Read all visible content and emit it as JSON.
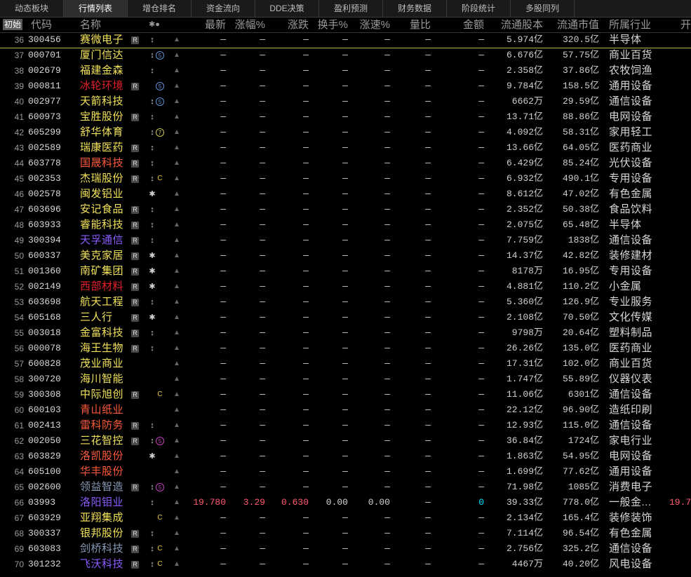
{
  "tabs": [
    "动态板块",
    "行情列表",
    "增仓排名",
    "资金流向",
    "DDE决策",
    "盈利预测",
    "财务数据",
    "阶段统计",
    "多股同列"
  ],
  "active_tab": 1,
  "header": {
    "init": "初始",
    "code": "代码",
    "name": "名称",
    "icons": "✱●",
    "latest": "最新",
    "pct": "涨幅%",
    "change": "涨跌",
    "turnover": "换手%",
    "speed": "涨速%",
    "vol_ratio": "量比",
    "amount": "金额",
    "float_shares": "流通股本",
    "float_value": "流通市值",
    "industry": "所属行业",
    "open": "开"
  },
  "colors": {
    "yellow": "#f2e25a",
    "red": "#e3202a",
    "orange_red": "#ff5a3a",
    "purple": "#8a5cff",
    "blue": "#5f8fd8",
    "cyan": "#00e0ff",
    "pink": "#ff5a6e",
    "bluegray": "#8a9ab8"
  },
  "rows": [
    {
      "idx": "36",
      "code": "300456",
      "name": "赛微电子",
      "nc": "#f2e25a",
      "r": "R",
      "i1": "↕",
      "i2": "",
      "i2c": "",
      "i2t": "",
      "latest": "—",
      "pct": "—",
      "chg": "—",
      "turn": "—",
      "speed": "—",
      "vr": "—",
      "amt": "—",
      "fs": "5.974亿",
      "fv": "320.5亿",
      "ind": "半导体",
      "open": ""
    },
    {
      "idx": "37",
      "code": "000701",
      "name": "厦门信达",
      "nc": "#f2e25a",
      "r": "",
      "i1": "↕",
      "i2": "5",
      "i2c": "#5f8fd8",
      "i2t": "circle",
      "latest": "—",
      "pct": "—",
      "chg": "—",
      "turn": "—",
      "speed": "—",
      "vr": "—",
      "amt": "—",
      "fs": "6.676亿",
      "fv": "57.75亿",
      "ind": "商业百货",
      "open": ""
    },
    {
      "idx": "38",
      "code": "002679",
      "name": "福建金森",
      "nc": "#f2e25a",
      "r": "",
      "i1": "↕",
      "i2": "",
      "i2c": "",
      "i2t": "",
      "latest": "—",
      "pct": "—",
      "chg": "—",
      "turn": "—",
      "speed": "—",
      "vr": "—",
      "amt": "—",
      "fs": "2.358亿",
      "fv": "37.86亿",
      "ind": "农牧饲渔",
      "open": ""
    },
    {
      "idx": "39",
      "code": "000811",
      "name": "冰轮环境",
      "nc": "#e3202a",
      "r": "R",
      "i1": "",
      "i2": "5",
      "i2c": "#5f8fd8",
      "i2t": "circle",
      "latest": "—",
      "pct": "—",
      "chg": "—",
      "turn": "—",
      "speed": "—",
      "vr": "—",
      "amt": "—",
      "fs": "9.784亿",
      "fv": "158.5亿",
      "ind": "通用设备",
      "open": ""
    },
    {
      "idx": "40",
      "code": "002977",
      "name": "天箭科技",
      "nc": "#f2e25a",
      "r": "",
      "i1": "↕",
      "i2": "5",
      "i2c": "#5f8fd8",
      "i2t": "circle",
      "latest": "—",
      "pct": "—",
      "chg": "—",
      "turn": "—",
      "speed": "—",
      "vr": "—",
      "amt": "—",
      "fs": "6662万",
      "fv": "29.59亿",
      "ind": "通信设备",
      "open": ""
    },
    {
      "idx": "41",
      "code": "600973",
      "name": "宝胜股份",
      "nc": "#f2e25a",
      "r": "R",
      "i1": "↕",
      "i2": "",
      "i2c": "",
      "i2t": "",
      "latest": "—",
      "pct": "—",
      "chg": "—",
      "turn": "—",
      "speed": "—",
      "vr": "—",
      "amt": "—",
      "fs": "13.71亿",
      "fv": "88.86亿",
      "ind": "电网设备",
      "open": ""
    },
    {
      "idx": "42",
      "code": "605299",
      "name": "舒华体育",
      "nc": "#f2e25a",
      "r": "",
      "i1": "↕",
      "i2": "7",
      "i2c": "#c8c85a",
      "i2t": "circle",
      "latest": "—",
      "pct": "—",
      "chg": "—",
      "turn": "—",
      "speed": "—",
      "vr": "—",
      "amt": "—",
      "fs": "4.092亿",
      "fv": "58.31亿",
      "ind": "家用轻工",
      "open": ""
    },
    {
      "idx": "43",
      "code": "002589",
      "name": "瑞康医药",
      "nc": "#f2e25a",
      "r": "R",
      "i1": "↕",
      "i2": "",
      "i2c": "",
      "i2t": "",
      "latest": "—",
      "pct": "—",
      "chg": "—",
      "turn": "—",
      "speed": "—",
      "vr": "—",
      "amt": "—",
      "fs": "13.66亿",
      "fv": "64.05亿",
      "ind": "医药商业",
      "open": ""
    },
    {
      "idx": "44",
      "code": "603778",
      "name": "国晟科技",
      "nc": "#ff5a3a",
      "r": "R",
      "i1": "↕",
      "i2": "",
      "i2c": "",
      "i2t": "",
      "latest": "—",
      "pct": "—",
      "chg": "—",
      "turn": "—",
      "speed": "—",
      "vr": "—",
      "amt": "—",
      "fs": "6.429亿",
      "fv": "85.24亿",
      "ind": "光伏设备",
      "open": ""
    },
    {
      "idx": "45",
      "code": "002353",
      "name": "杰瑞股份",
      "nc": "#f2e25a",
      "r": "R",
      "i1": "↕",
      "i2": "C",
      "i2c": "#e8c830",
      "i2t": "letter",
      "latest": "—",
      "pct": "—",
      "chg": "—",
      "turn": "—",
      "speed": "—",
      "vr": "—",
      "amt": "—",
      "fs": "6.932亿",
      "fv": "490.1亿",
      "ind": "专用设备",
      "open": ""
    },
    {
      "idx": "46",
      "code": "002578",
      "name": "闽发铝业",
      "nc": "#f2e25a",
      "r": "",
      "i1": "✱",
      "i2": "",
      "i2c": "",
      "i2t": "",
      "latest": "—",
      "pct": "—",
      "chg": "—",
      "turn": "—",
      "speed": "—",
      "vr": "—",
      "amt": "—",
      "fs": "8.612亿",
      "fv": "47.02亿",
      "ind": "有色金属",
      "open": ""
    },
    {
      "idx": "47",
      "code": "603696",
      "name": "安记食品",
      "nc": "#f2e25a",
      "r": "R",
      "i1": "↕",
      "i2": "",
      "i2c": "",
      "i2t": "",
      "latest": "—",
      "pct": "—",
      "chg": "—",
      "turn": "—",
      "speed": "—",
      "vr": "—",
      "amt": "—",
      "fs": "2.352亿",
      "fv": "50.38亿",
      "ind": "食品饮料",
      "open": ""
    },
    {
      "idx": "48",
      "code": "603933",
      "name": "睿能科技",
      "nc": "#f2e25a",
      "r": "R",
      "i1": "↕",
      "i2": "",
      "i2c": "",
      "i2t": "",
      "latest": "—",
      "pct": "—",
      "chg": "—",
      "turn": "—",
      "speed": "—",
      "vr": "—",
      "amt": "—",
      "fs": "2.075亿",
      "fv": "65.48亿",
      "ind": "半导体",
      "open": ""
    },
    {
      "idx": "49",
      "code": "300394",
      "name": "天孚通信",
      "nc": "#8a5cff",
      "r": "R",
      "i1": "↕",
      "i2": "",
      "i2c": "",
      "i2t": "",
      "latest": "—",
      "pct": "—",
      "chg": "—",
      "turn": "—",
      "speed": "—",
      "vr": "—",
      "amt": "—",
      "fs": "7.759亿",
      "fv": "1838亿",
      "ind": "通信设备",
      "open": ""
    },
    {
      "idx": "50",
      "code": "600337",
      "name": "美克家居",
      "nc": "#f2e25a",
      "r": "R",
      "i1": "✱",
      "i2": "",
      "i2c": "",
      "i2t": "",
      "latest": "—",
      "pct": "—",
      "chg": "—",
      "turn": "—",
      "speed": "—",
      "vr": "—",
      "amt": "—",
      "fs": "14.37亿",
      "fv": "42.82亿",
      "ind": "装修建材",
      "open": ""
    },
    {
      "idx": "51",
      "code": "001360",
      "name": "南矿集团",
      "nc": "#f2e25a",
      "r": "R",
      "i1": "✱",
      "i2": "",
      "i2c": "",
      "i2t": "",
      "latest": "—",
      "pct": "—",
      "chg": "—",
      "turn": "—",
      "speed": "—",
      "vr": "—",
      "amt": "—",
      "fs": "8178万",
      "fv": "16.95亿",
      "ind": "专用设备",
      "open": ""
    },
    {
      "idx": "52",
      "code": "002149",
      "name": "西部材料",
      "nc": "#e3202a",
      "r": "R",
      "i1": "✱",
      "i2": "",
      "i2c": "",
      "i2t": "",
      "latest": "—",
      "pct": "—",
      "chg": "—",
      "turn": "—",
      "speed": "—",
      "vr": "—",
      "amt": "—",
      "fs": "4.881亿",
      "fv": "110.2亿",
      "ind": "小金属",
      "open": ""
    },
    {
      "idx": "53",
      "code": "603698",
      "name": "航天工程",
      "nc": "#f2e25a",
      "r": "R",
      "i1": "↕",
      "i2": "",
      "i2c": "",
      "i2t": "",
      "latest": "—",
      "pct": "—",
      "chg": "—",
      "turn": "—",
      "speed": "—",
      "vr": "—",
      "amt": "—",
      "fs": "5.360亿",
      "fv": "126.9亿",
      "ind": "专业服务",
      "open": ""
    },
    {
      "idx": "54",
      "code": "605168",
      "name": "三人行",
      "nc": "#f2e25a",
      "r": "R",
      "i1": "✱",
      "i2": "",
      "i2c": "",
      "i2t": "",
      "latest": "—",
      "pct": "—",
      "chg": "—",
      "turn": "—",
      "speed": "—",
      "vr": "—",
      "amt": "—",
      "fs": "2.108亿",
      "fv": "70.50亿",
      "ind": "文化传媒",
      "open": ""
    },
    {
      "idx": "55",
      "code": "003018",
      "name": "金富科技",
      "nc": "#f2e25a",
      "r": "R",
      "i1": "↕",
      "i2": "",
      "i2c": "",
      "i2t": "",
      "latest": "—",
      "pct": "—",
      "chg": "—",
      "turn": "—",
      "speed": "—",
      "vr": "—",
      "amt": "—",
      "fs": "9798万",
      "fv": "20.64亿",
      "ind": "塑料制品",
      "open": ""
    },
    {
      "idx": "56",
      "code": "000078",
      "name": "海王生物",
      "nc": "#f2e25a",
      "r": "R",
      "i1": "↕",
      "i2": "",
      "i2c": "",
      "i2t": "",
      "latest": "—",
      "pct": "—",
      "chg": "—",
      "turn": "—",
      "speed": "—",
      "vr": "—",
      "amt": "—",
      "fs": "26.26亿",
      "fv": "135.0亿",
      "ind": "医药商业",
      "open": ""
    },
    {
      "idx": "57",
      "code": "600828",
      "name": "茂业商业",
      "nc": "#f2e25a",
      "r": "",
      "i1": "",
      "i2": "",
      "i2c": "",
      "i2t": "",
      "latest": "—",
      "pct": "—",
      "chg": "—",
      "turn": "—",
      "speed": "—",
      "vr": "—",
      "amt": "—",
      "fs": "17.31亿",
      "fv": "102.0亿",
      "ind": "商业百货",
      "open": ""
    },
    {
      "idx": "58",
      "code": "300720",
      "name": "海川智能",
      "nc": "#f2e25a",
      "r": "",
      "i1": "",
      "i2": "",
      "i2c": "",
      "i2t": "",
      "latest": "—",
      "pct": "—",
      "chg": "—",
      "turn": "—",
      "speed": "—",
      "vr": "—",
      "amt": "—",
      "fs": "1.747亿",
      "fv": "55.89亿",
      "ind": "仪器仪表",
      "open": ""
    },
    {
      "idx": "59",
      "code": "300308",
      "name": "中际旭创",
      "nc": "#f2e25a",
      "r": "R",
      "i1": "",
      "i2": "C",
      "i2c": "#e8c830",
      "i2t": "letter",
      "latest": "—",
      "pct": "—",
      "chg": "—",
      "turn": "—",
      "speed": "—",
      "vr": "—",
      "amt": "—",
      "fs": "11.06亿",
      "fv": "6301亿",
      "ind": "通信设备",
      "open": ""
    },
    {
      "idx": "60",
      "code": "600103",
      "name": "青山纸业",
      "nc": "#ff5a3a",
      "r": "",
      "i1": "",
      "i2": "",
      "i2c": "",
      "i2t": "",
      "latest": "—",
      "pct": "—",
      "chg": "—",
      "turn": "—",
      "speed": "—",
      "vr": "—",
      "amt": "—",
      "fs": "22.12亿",
      "fv": "96.90亿",
      "ind": "造纸印刷",
      "open": ""
    },
    {
      "idx": "61",
      "code": "002413",
      "name": "雷科防务",
      "nc": "#ff5a3a",
      "r": "R",
      "i1": "↕",
      "i2": "",
      "i2c": "",
      "i2t": "",
      "latest": "—",
      "pct": "—",
      "chg": "—",
      "turn": "—",
      "speed": "—",
      "vr": "—",
      "amt": "—",
      "fs": "12.93亿",
      "fv": "115.0亿",
      "ind": "通信设备",
      "open": ""
    },
    {
      "idx": "62",
      "code": "002050",
      "name": "三花智控",
      "nc": "#f2e25a",
      "r": "R",
      "i1": "↕",
      "i2": "5",
      "i2c": "#c040c0",
      "i2t": "circle",
      "latest": "—",
      "pct": "—",
      "chg": "—",
      "turn": "—",
      "speed": "—",
      "vr": "—",
      "amt": "—",
      "fs": "36.84亿",
      "fv": "1724亿",
      "ind": "家电行业",
      "open": ""
    },
    {
      "idx": "63",
      "code": "603829",
      "name": "洛凯股份",
      "nc": "#ff5a3a",
      "r": "",
      "i1": "✱",
      "i2": "",
      "i2c": "",
      "i2t": "",
      "latest": "—",
      "pct": "—",
      "chg": "—",
      "turn": "—",
      "speed": "—",
      "vr": "—",
      "amt": "—",
      "fs": "1.863亿",
      "fv": "54.95亿",
      "ind": "电网设备",
      "open": ""
    },
    {
      "idx": "64",
      "code": "605100",
      "name": "华丰股份",
      "nc": "#ff5a3a",
      "r": "",
      "i1": "",
      "i2": "",
      "i2c": "",
      "i2t": "",
      "latest": "—",
      "pct": "—",
      "chg": "—",
      "turn": "—",
      "speed": "—",
      "vr": "—",
      "amt": "—",
      "fs": "1.699亿",
      "fv": "77.62亿",
      "ind": "通用设备",
      "open": ""
    },
    {
      "idx": "65",
      "code": "002600",
      "name": "领益智造",
      "nc": "#8a9ab8",
      "r": "R",
      "i1": "↕",
      "i2": "5",
      "i2c": "#c040c0",
      "i2t": "circle",
      "latest": "—",
      "pct": "—",
      "chg": "—",
      "turn": "—",
      "speed": "—",
      "vr": "—",
      "amt": "—",
      "fs": "71.98亿",
      "fv": "1085亿",
      "ind": "消费电子",
      "open": ""
    },
    {
      "idx": "66",
      "code": "03993",
      "name": "洛阳钼业",
      "nc": "#8a5cff",
      "r": "",
      "i1": "↕",
      "i2": "",
      "i2c": "",
      "i2t": "",
      "latest": "19.780",
      "pct": "3.29",
      "chg": "0.630",
      "turn": "0.00",
      "speed": "0.00",
      "vr": "—",
      "amt": "0",
      "fs": "39.33亿",
      "fv": "778.0亿",
      "ind": "一般金...",
      "open": "19.7"
    },
    {
      "idx": "67",
      "code": "603929",
      "name": "亚翔集成",
      "nc": "#f2e25a",
      "r": "",
      "i1": "",
      "i2": "C",
      "i2c": "#e8c830",
      "i2t": "letter",
      "latest": "—",
      "pct": "—",
      "chg": "—",
      "turn": "—",
      "speed": "—",
      "vr": "—",
      "amt": "—",
      "fs": "2.134亿",
      "fv": "165.4亿",
      "ind": "装修装饰",
      "open": ""
    },
    {
      "idx": "68",
      "code": "300337",
      "name": "银邦股份",
      "nc": "#f2e25a",
      "r": "R",
      "i1": "↕",
      "i2": "",
      "i2c": "",
      "i2t": "",
      "latest": "—",
      "pct": "—",
      "chg": "—",
      "turn": "—",
      "speed": "—",
      "vr": "—",
      "amt": "—",
      "fs": "7.114亿",
      "fv": "96.54亿",
      "ind": "有色金属",
      "open": ""
    },
    {
      "idx": "69",
      "code": "603083",
      "name": "剑桥科技",
      "nc": "#8a9ab8",
      "r": "R",
      "i1": "↕",
      "i2": "C",
      "i2c": "#e8c830",
      "i2t": "letter",
      "latest": "—",
      "pct": "—",
      "chg": "—",
      "turn": "—",
      "speed": "—",
      "vr": "—",
      "amt": "—",
      "fs": "2.756亿",
      "fv": "325.2亿",
      "ind": "通信设备",
      "open": ""
    },
    {
      "idx": "70",
      "code": "301232",
      "name": "飞沃科技",
      "nc": "#8a5cff",
      "r": "R",
      "i1": "↕",
      "i2": "C",
      "i2c": "#e8c830",
      "i2t": "letter",
      "latest": "—",
      "pct": "—",
      "chg": "—",
      "turn": "—",
      "speed": "—",
      "vr": "—",
      "amt": "—",
      "fs": "4467万",
      "fv": "40.20亿",
      "ind": "风电设备",
      "open": ""
    }
  ]
}
